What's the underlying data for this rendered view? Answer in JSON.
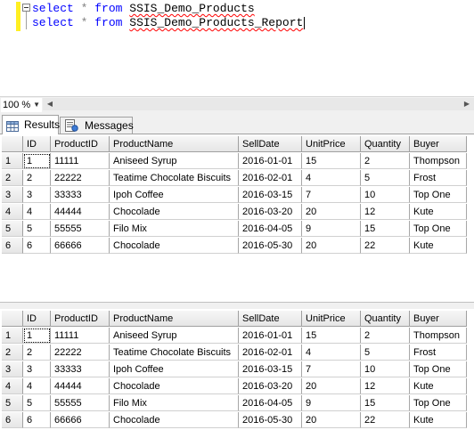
{
  "editor": {
    "lines": [
      {
        "kw1": "select",
        "op": "*",
        "kw2": "from",
        "table": "SSIS_Demo_Products"
      },
      {
        "kw1": "select",
        "op": "*",
        "kw2": "from",
        "table": "SSIS_Demo_Products_Report"
      }
    ]
  },
  "zoom": {
    "value": "100 %"
  },
  "tabs": {
    "results": "Results",
    "messages": "Messages"
  },
  "columns": [
    "ID",
    "ProductID",
    "ProductName",
    "SellDate",
    "UnitPrice",
    "Quantity",
    "Buyer"
  ],
  "grid1": {
    "rows": [
      {
        "rn": "1",
        "ID": "1",
        "ProductID": "11111",
        "ProductName": "Aniseed Syrup",
        "SellDate": "2016-01-01",
        "UnitPrice": "15",
        "Quantity": "2",
        "Buyer": "Thompson"
      },
      {
        "rn": "2",
        "ID": "2",
        "ProductID": "22222",
        "ProductName": "Teatime Chocolate Biscuits",
        "SellDate": "2016-02-01",
        "UnitPrice": "4",
        "Quantity": "5",
        "Buyer": "Frost"
      },
      {
        "rn": "3",
        "ID": "3",
        "ProductID": "33333",
        "ProductName": "Ipoh Coffee",
        "SellDate": "2016-03-15",
        "UnitPrice": "7",
        "Quantity": "10",
        "Buyer": "Top One"
      },
      {
        "rn": "4",
        "ID": "4",
        "ProductID": "44444",
        "ProductName": "Chocolade",
        "SellDate": "2016-03-20",
        "UnitPrice": "20",
        "Quantity": "12",
        "Buyer": "Kute"
      },
      {
        "rn": "5",
        "ID": "5",
        "ProductID": "55555",
        "ProductName": "Filo Mix",
        "SellDate": "2016-04-05",
        "UnitPrice": "9",
        "Quantity": "15",
        "Buyer": "Top One"
      },
      {
        "rn": "6",
        "ID": "6",
        "ProductID": "66666",
        "ProductName": "Chocolade",
        "SellDate": "2016-05-30",
        "UnitPrice": "20",
        "Quantity": "22",
        "Buyer": "Kute"
      }
    ]
  },
  "grid2": {
    "rows": [
      {
        "rn": "1",
        "ID": "1",
        "ProductID": "11111",
        "ProductName": "Aniseed Syrup",
        "SellDate": "2016-01-01",
        "UnitPrice": "15",
        "Quantity": "2",
        "Buyer": "Thompson"
      },
      {
        "rn": "2",
        "ID": "2",
        "ProductID": "22222",
        "ProductName": "Teatime Chocolate Biscuits",
        "SellDate": "2016-02-01",
        "UnitPrice": "4",
        "Quantity": "5",
        "Buyer": "Frost"
      },
      {
        "rn": "3",
        "ID": "3",
        "ProductID": "33333",
        "ProductName": "Ipoh Coffee",
        "SellDate": "2016-03-15",
        "UnitPrice": "7",
        "Quantity": "10",
        "Buyer": "Top One"
      },
      {
        "rn": "4",
        "ID": "4",
        "ProductID": "44444",
        "ProductName": "Chocolade",
        "SellDate": "2016-03-20",
        "UnitPrice": "20",
        "Quantity": "12",
        "Buyer": "Kute"
      },
      {
        "rn": "5",
        "ID": "5",
        "ProductID": "55555",
        "ProductName": "Filo Mix",
        "SellDate": "2016-04-05",
        "UnitPrice": "9",
        "Quantity": "15",
        "Buyer": "Top One"
      },
      {
        "rn": "6",
        "ID": "6",
        "ProductID": "66666",
        "ProductName": "Chocolade",
        "SellDate": "2016-05-30",
        "UnitPrice": "20",
        "Quantity": "22",
        "Buyer": "Kute"
      }
    ]
  },
  "colors": {
    "keyword": "#0000ff",
    "operator": "#808080",
    "squiggle": "#ff0000",
    "changeBar": "#ffef22"
  }
}
